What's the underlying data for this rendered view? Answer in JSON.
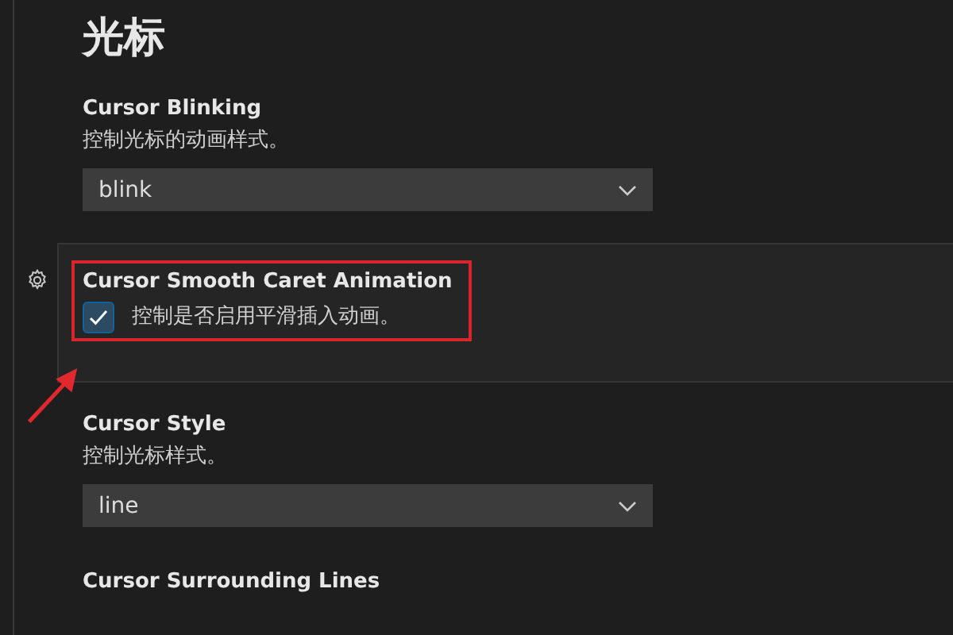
{
  "heading": "光标",
  "settings": [
    {
      "kind": "dropdown",
      "title": "Cursor Blinking",
      "description": "控制光标的动画样式。",
      "value": "blink",
      "focused": false
    },
    {
      "kind": "checkbox",
      "title": "Cursor Smooth Caret Animation",
      "description": "控制是否启用平滑插入动画。",
      "checked": true,
      "focused": true
    },
    {
      "kind": "dropdown",
      "title": "Cursor Style",
      "description": "控制光标样式。",
      "value": "line",
      "focused": false
    },
    {
      "kind": "title-only",
      "title": "Cursor Surrounding Lines",
      "focused": false
    }
  ]
}
